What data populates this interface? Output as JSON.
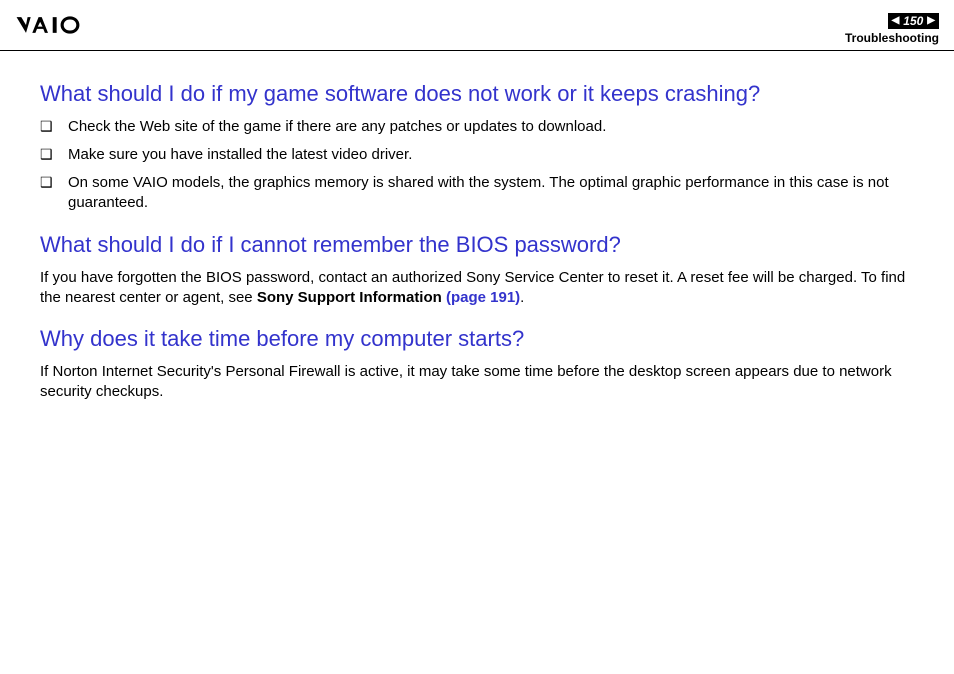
{
  "header": {
    "page_number": "150",
    "section": "Troubleshooting"
  },
  "sections": [
    {
      "heading": "What should I do if my game software does not work or it keeps crashing?",
      "bullets": [
        "Check the Web site of the game if there are any patches or updates to download.",
        "Make sure you have installed the latest video driver.",
        "On some VAIO models, the graphics memory is shared with the system. The optimal graphic performance in this case is not guaranteed."
      ]
    },
    {
      "heading": "What should I do if I cannot remember the BIOS password?",
      "body_parts": {
        "text1": "If you have forgotten the BIOS password, contact an authorized Sony Service Center to reset it. A reset fee will be charged. To find the nearest center or agent, see ",
        "bold": "Sony Support Information ",
        "link": "(page 191)",
        "text2": "."
      }
    },
    {
      "heading": "Why does it take time before my computer starts?",
      "body": "If Norton Internet Security's Personal Firewall is active, it may take some time before the desktop screen appears due to network security checkups."
    }
  ]
}
